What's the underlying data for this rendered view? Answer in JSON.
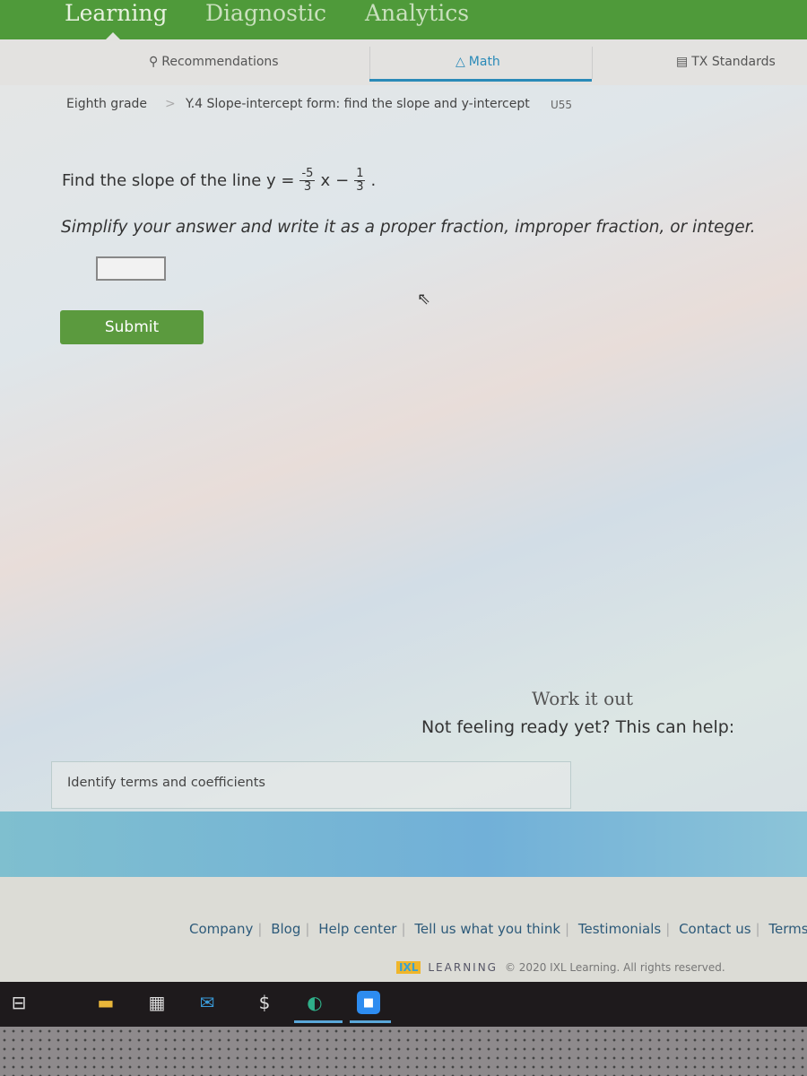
{
  "top_tabs": [
    "Learning",
    "Diagnostic",
    "Analytics"
  ],
  "subnav": {
    "recommendations": "Recommendations",
    "math": "Math",
    "standards": "TX Standards"
  },
  "breadcrumb": {
    "grade": "Eighth grade",
    "separator": ">",
    "skill": "Y.4 Slope-intercept form: find the slope and y-intercept",
    "code": "U55"
  },
  "question": {
    "prefix": "Find the slope of the line y =",
    "num1": "-5",
    "den1": "3",
    "x": "x",
    "minus": "−",
    "num2": "1",
    "den2": "3",
    "end": "."
  },
  "instructions": "Simplify your answer and write it as a proper fraction, improper fraction, or integer.",
  "answer": {
    "value": ""
  },
  "submit_label": "Submit",
  "work_it_out": "Work it out",
  "help_text": "Not feeling ready yet? This can help:",
  "help_link": "Identify terms and coefficients",
  "footer": {
    "links": [
      "Company",
      "Blog",
      "Help center",
      "Tell us what you think",
      "Testimonials",
      "Contact us",
      "Terms of"
    ],
    "logo": "IXL",
    "logo_text": "LEARNING",
    "copyright": "© 2020 IXL Learning. All rights reserved."
  },
  "taskbar": {
    "icons": [
      "task-view-icon",
      "file-explorer-icon",
      "store-icon",
      "mail-icon",
      "app-icon",
      "edge-icon",
      "zoom-icon"
    ]
  },
  "colors": {
    "header": "#4f9a3a",
    "submit": "#5b9a3e",
    "accent": "#2a8ab8"
  }
}
